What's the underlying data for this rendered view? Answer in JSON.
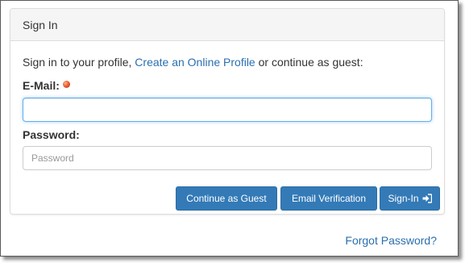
{
  "panel": {
    "title": "Sign In"
  },
  "intro": {
    "prefix": "Sign in to your profile,",
    "link_text": "Create an Online Profile",
    "suffix": "or continue as guest:"
  },
  "email": {
    "label": "E-Mail:",
    "value": "",
    "placeholder": "",
    "required_icon": "required-dot-icon"
  },
  "password": {
    "label": "Password:",
    "value": "",
    "placeholder": "Password"
  },
  "buttons": {
    "continue_guest": "Continue as Guest",
    "email_verification": "Email Verification",
    "sign_in": "Sign-In",
    "sign_in_icon": "sign-in-icon"
  },
  "footer": {
    "forgot_password": "Forgot Password?"
  },
  "colors": {
    "primary": "#337ab7",
    "link": "#2a6fb0",
    "required": "#e2541f",
    "focus_border": "#66afe9"
  }
}
